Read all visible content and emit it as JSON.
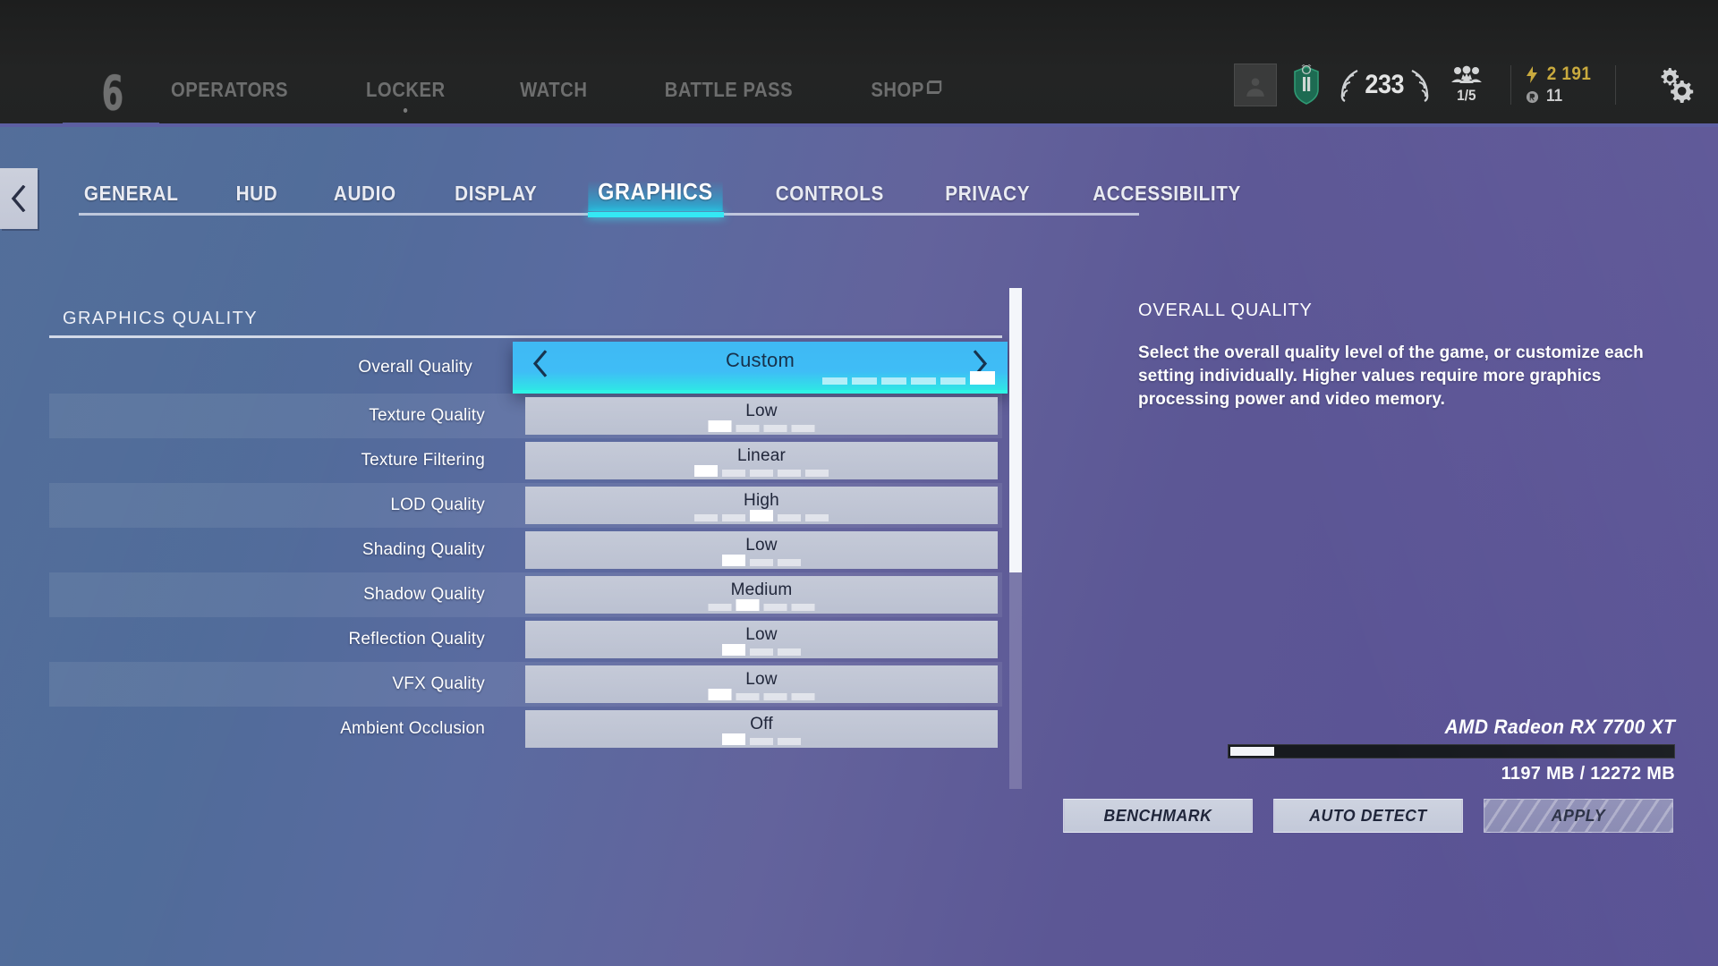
{
  "topbar": {
    "logo": "6",
    "nav": [
      {
        "label": "OPERATORS",
        "dot": false,
        "tag": false
      },
      {
        "label": "LOCKER",
        "dot": true,
        "tag": false
      },
      {
        "label": "WATCH",
        "dot": false,
        "tag": false
      },
      {
        "label": "BATTLE PASS",
        "dot": false,
        "tag": false
      },
      {
        "label": "SHOP",
        "dot": false,
        "tag": true
      }
    ],
    "hud": {
      "avatar_icon": "person-avatar-icon",
      "rank_icon": "rank-badge-icon",
      "laurel_icon": "laurel-wreath-icon",
      "level": "233",
      "squad_icon": "squad-group-icon",
      "squad_count": "1/5",
      "renown_icon": "lightning-bolt-icon",
      "renown": "2 191",
      "credits_icon": "r6-credit-icon",
      "credits": "11",
      "settings_icon": "gear-icon"
    }
  },
  "back_button": {
    "icon": "chevron-left-icon"
  },
  "tabs": {
    "items": [
      {
        "label": "GENERAL",
        "active": false
      },
      {
        "label": "HUD",
        "active": false
      },
      {
        "label": "AUDIO",
        "active": false
      },
      {
        "label": "DISPLAY",
        "active": false
      },
      {
        "label": "GRAPHICS",
        "active": true
      },
      {
        "label": "CONTROLS",
        "active": false
      },
      {
        "label": "PRIVACY",
        "active": false
      },
      {
        "label": "ACCESSIBILITY",
        "active": false
      }
    ]
  },
  "settings": {
    "section_title": "GRAPHICS QUALITY",
    "rows": [
      {
        "label": "Overall Quality",
        "value": "Custom",
        "segments": 6,
        "active_index": 5,
        "selected": true
      },
      {
        "label": "Texture Quality",
        "value": "Low",
        "segments": 4,
        "active_index": 0,
        "selected": false
      },
      {
        "label": "Texture Filtering",
        "value": "Linear",
        "segments": 5,
        "active_index": 0,
        "selected": false
      },
      {
        "label": "LOD Quality",
        "value": "High",
        "segments": 5,
        "active_index": 2,
        "selected": false
      },
      {
        "label": "Shading Quality",
        "value": "Low",
        "segments": 3,
        "active_index": 0,
        "selected": false
      },
      {
        "label": "Shadow Quality",
        "value": "Medium",
        "segments": 4,
        "active_index": 1,
        "selected": false
      },
      {
        "label": "Reflection Quality",
        "value": "Low",
        "segments": 3,
        "active_index": 0,
        "selected": false
      },
      {
        "label": "VFX Quality",
        "value": "Low",
        "segments": 4,
        "active_index": 0,
        "selected": false
      },
      {
        "label": "Ambient Occlusion",
        "value": "Off",
        "segments": 3,
        "active_index": 0,
        "selected": false
      }
    ],
    "arrow_left_icon": "chevron-left-icon",
    "arrow_right_icon": "chevron-right-icon"
  },
  "info_panel": {
    "title": "OVERALL QUALITY",
    "description": "Select the overall quality level of the game, or customize each setting individually. Higher values require more graphics processing power and video memory."
  },
  "vram": {
    "gpu_name": "AMD Radeon RX 7700 XT",
    "usage_text": "1197 MB / 12272 MB",
    "used_mb": 1197,
    "total_mb": 12272,
    "fill_percent": 9.8
  },
  "buttons": [
    {
      "label": "BENCHMARK",
      "disabled": false
    },
    {
      "label": "AUTO DETECT",
      "disabled": false
    },
    {
      "label": "APPLY",
      "disabled": true
    }
  ],
  "colors": {
    "accent_cyan": "#34e8f4",
    "selected_blue": "#3fb9f4",
    "bg_left": "#4c6896",
    "bg_right": "#575093",
    "topbar": "#232424",
    "gold": "#c9aa3e",
    "topbar_accent": "#5d5fa2"
  }
}
